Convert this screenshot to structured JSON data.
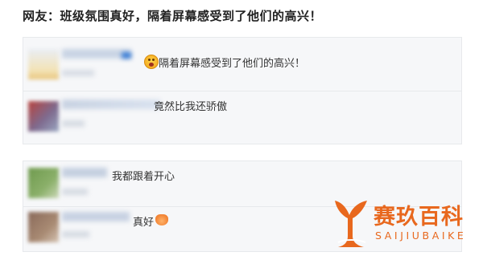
{
  "post": {
    "headline": "网友：班级氛围真好，隔着屏幕感受到了他们的高兴！"
  },
  "comments": [
    {
      "text": "隔着屏幕感受到了他们的高兴！",
      "icon": "shocked-face-emoji-icon"
    },
    {
      "text": "竟然比我还骄傲"
    },
    {
      "text": "我都跟着开心"
    },
    {
      "text": "真好",
      "icon": "clapping-hands-emoji-icon"
    }
  ],
  "watermark": {
    "name_cn": "赛玖百科",
    "name_en": "SAIJIUBAIKE"
  },
  "colors": {
    "accent": "#e8681e",
    "card_bg": "#f6f7f9"
  }
}
